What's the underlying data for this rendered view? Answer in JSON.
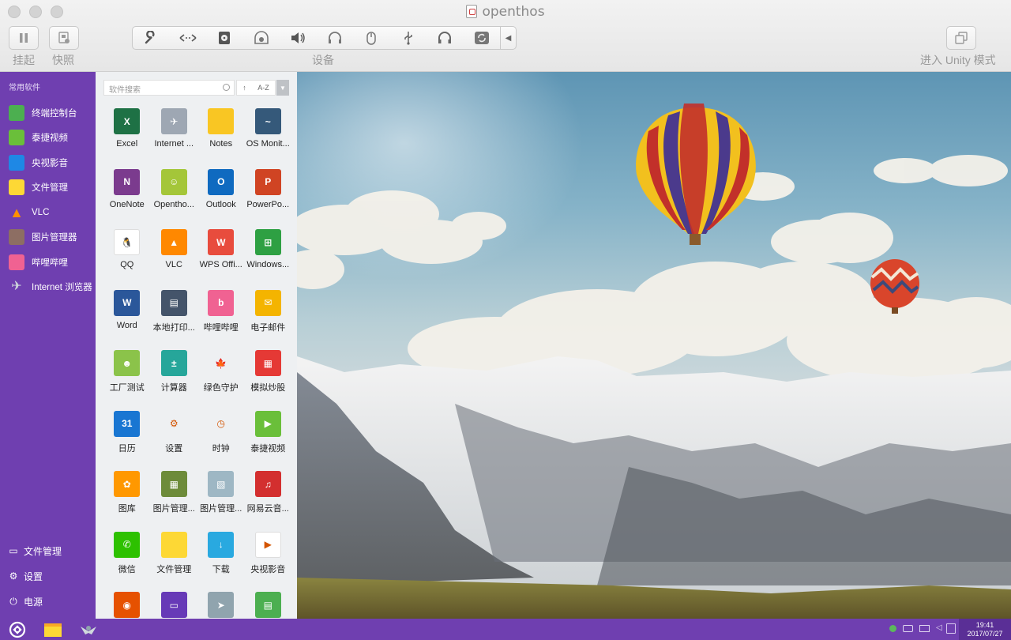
{
  "window": {
    "title": "openthos"
  },
  "toolbar": {
    "suspend_label": "挂起",
    "snapshot_label": "快照",
    "devices_label": "设备",
    "unity_label": "进入 Unity 模式",
    "device_icons": [
      "wrench-icon",
      "network-icon",
      "cd-icon",
      "camera-icon",
      "speaker-icon",
      "headphones-icon",
      "mouse-icon",
      "usb-icon",
      "headset-icon",
      "sync-icon"
    ]
  },
  "dock": {
    "header": "常用软件",
    "items": [
      {
        "label": "终端控制台",
        "icon": "terminal-icon",
        "color": "#4caf50"
      },
      {
        "label": "泰捷视频",
        "icon": "tv-icon",
        "color": "#6abf3a"
      },
      {
        "label": "央视影音",
        "icon": "cctv-icon",
        "color": "#1e88e5"
      },
      {
        "label": "文件管理",
        "icon": "folder-icon",
        "color": "#fdd835"
      },
      {
        "label": "VLC",
        "icon": "vlc-icon",
        "color": "#ff8f00"
      },
      {
        "label": "图片管理器",
        "icon": "gallery-icon",
        "color": "#8d6e63"
      },
      {
        "label": "哔哩哔哩",
        "icon": "bilibili-icon",
        "color": "#f06292"
      },
      {
        "label": "Internet 浏览器",
        "icon": "browser-icon",
        "color": "#90a4ae"
      }
    ],
    "bottom": [
      {
        "label": "文件管理",
        "glyph": "▭"
      },
      {
        "label": "设置",
        "glyph": "⚙"
      },
      {
        "label": "电源",
        "glyph": "⏻"
      }
    ]
  },
  "launcher": {
    "search_placeholder": "软件搜索",
    "sort_label": "A-Z",
    "apps": [
      {
        "label": "Excel",
        "color": "#1e7145",
        "glyph": "X"
      },
      {
        "label": "Internet ...",
        "color": "#9ea7b3",
        "glyph": "✈"
      },
      {
        "label": "Notes",
        "color": "#f9c623",
        "glyph": ""
      },
      {
        "label": "OS Monit...",
        "color": "#35597a",
        "glyph": "~"
      },
      {
        "label": "OneNote",
        "color": "#7b3b8e",
        "glyph": "N"
      },
      {
        "label": "Opentho...",
        "color": "#a4c639",
        "glyph": "☺"
      },
      {
        "label": "Outlook",
        "color": "#0f6ac0",
        "glyph": "O"
      },
      {
        "label": "PowerPo...",
        "color": "#d04423",
        "glyph": "P"
      },
      {
        "label": "QQ",
        "color": "#ffffff",
        "glyph": "🐧"
      },
      {
        "label": "VLC",
        "color": "#ff8800",
        "glyph": "▲"
      },
      {
        "label": "WPS Offi...",
        "color": "#e84c3d",
        "glyph": "W"
      },
      {
        "label": "Windows...",
        "color": "#2ea043",
        "glyph": "⊞"
      },
      {
        "label": "Word",
        "color": "#2b579a",
        "glyph": "W"
      },
      {
        "label": "本地打印...",
        "color": "#44546a",
        "glyph": "▤"
      },
      {
        "label": "哔哩哔哩",
        "color": "#f06292",
        "glyph": "b"
      },
      {
        "label": "电子邮件",
        "color": "#f4b400",
        "glyph": "✉"
      },
      {
        "label": "工厂测试",
        "color": "#8bc34a",
        "glyph": "☻"
      },
      {
        "label": "计算器",
        "color": "#26a69a",
        "glyph": "±"
      },
      {
        "label": "绿色守护",
        "color": "#eef0f2",
        "glyph": "🍁"
      },
      {
        "label": "模拟炒股",
        "color": "#e53935",
        "glyph": "▦"
      },
      {
        "label": "日历",
        "color": "#1976d2",
        "glyph": "31"
      },
      {
        "label": "设置",
        "color": "#eef0f2",
        "glyph": "⚙"
      },
      {
        "label": "时钟",
        "color": "#eef0f2",
        "glyph": "◷"
      },
      {
        "label": "泰捷视频",
        "color": "#6abf3a",
        "glyph": "▶"
      },
      {
        "label": "图库",
        "color": "#ff9800",
        "glyph": "✿"
      },
      {
        "label": "图片管理...",
        "color": "#6d8b3a",
        "glyph": "▦"
      },
      {
        "label": "图片管理...",
        "color": "#9eb7c4",
        "glyph": "▧"
      },
      {
        "label": "网易云音...",
        "color": "#d32f2f",
        "glyph": "♫"
      },
      {
        "label": "微信",
        "color": "#2dc100",
        "glyph": "✆"
      },
      {
        "label": "文件管理",
        "color": "#fdd835",
        "glyph": ""
      },
      {
        "label": "下载",
        "color": "#29a9e0",
        "glyph": "↓"
      },
      {
        "label": "央视影音",
        "color": "#ffffff",
        "glyph": "▶"
      },
      {
        "label": "",
        "color": "#e65100",
        "glyph": "◉"
      },
      {
        "label": "",
        "color": "#673ab7",
        "glyph": "▭"
      },
      {
        "label": "",
        "color": "#90a4ae",
        "glyph": "➤"
      },
      {
        "label": "",
        "color": "#4caf50",
        "glyph": "▤"
      }
    ]
  },
  "taskbar": {
    "time": "19:41",
    "date": "2017/07/27"
  }
}
